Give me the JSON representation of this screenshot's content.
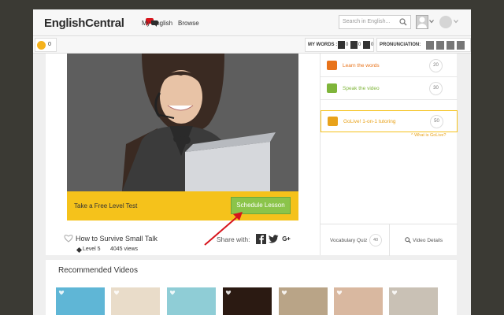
{
  "header": {
    "logo_text": "EnglishCentral",
    "nav": [
      "My English",
      "Browse"
    ],
    "search_placeholder": "Search in English..."
  },
  "stats": {
    "star_count": "0",
    "my_words_label": "MY WORDS :",
    "my_words_counts": [
      "0",
      "0",
      "0"
    ],
    "pronunciation_label": "PRONUNCIATION:",
    "pronunciation_buttons": [
      "",
      "",
      "",
      ""
    ]
  },
  "video": {
    "cta_text": "Take a Free Level Test",
    "cta_button": "Schedule Lesson",
    "title": "How to Survive Small Talk",
    "level": "Level 5",
    "views": "4045 views",
    "share_label": "Share with:"
  },
  "sidebar": {
    "activities": [
      {
        "label": "Learn the words",
        "count": "20",
        "color": "#e8731a",
        "active": false
      },
      {
        "label": "Speak the video",
        "count": "30",
        "color": "#7fb53a",
        "active": false
      },
      {
        "label": "GoLive! 1-on-1 tutoring",
        "count": "50",
        "color": "#e8a21a",
        "active": true
      }
    ],
    "golink_text": "What is GoLive?",
    "vocab_quiz_label": "Vocabulary Quiz",
    "vocab_quiz_count": "40",
    "video_details_label": "Video Details"
  },
  "recommended": {
    "title": "Recommended Videos",
    "thumbs": [
      "#5fb6d6",
      "#e9dcc9",
      "#8fcdd6",
      "#2b1a12",
      "#b9a487",
      "#d9b8a0",
      "#c9c1b5"
    ]
  },
  "colors": {
    "accent_yellow": "#f5c21b",
    "accent_green": "#8bc44a",
    "annotation_red": "#d7141c"
  }
}
